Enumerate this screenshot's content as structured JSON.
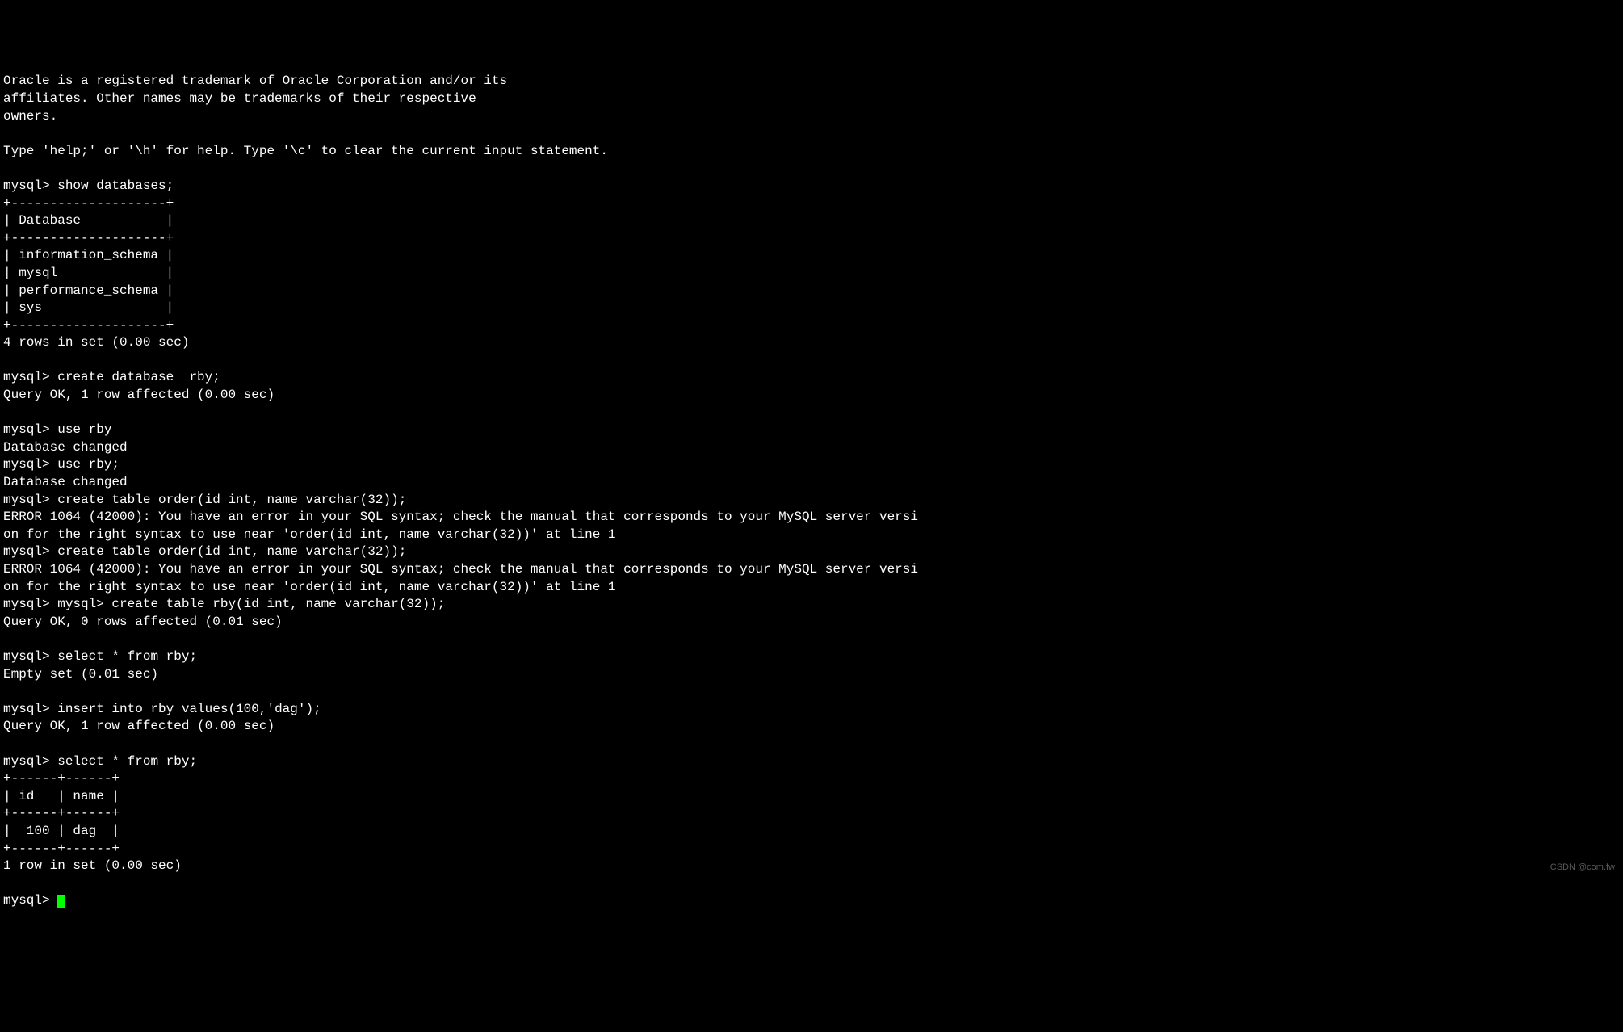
{
  "terminal": {
    "intro_line1": "Oracle is a registered trademark of Oracle Corporation and/or its",
    "intro_line2": "affiliates. Other names may be trademarks of their respective",
    "intro_line3": "owners.",
    "help_line": "Type 'help;' or '\\h' for help. Type '\\c' to clear the current input statement.",
    "prompt": "mysql> ",
    "cmd_show_databases": "show databases;",
    "table_border": "+--------------------+",
    "table_header": "| Database           |",
    "db_row1": "| information_schema |",
    "db_row2": "| mysql              |",
    "db_row3": "| performance_schema |",
    "db_row4": "| sys                |",
    "rows_result1": "4 rows in set (0.00 sec)",
    "cmd_create_db": "create database  rby;",
    "query_ok1": "Query OK, 1 row affected (0.00 sec)",
    "cmd_use_rby1": "use rby",
    "db_changed": "Database changed",
    "cmd_use_rby2": "use rby;",
    "cmd_create_table_order": "create table order(id int, name varchar(32));",
    "error_line1": "ERROR 1064 (42000): You have an error in your SQL syntax; check the manual that corresponds to your MySQL server versi",
    "error_line2": "on for the right syntax to use near 'order(id int, name varchar(32))' at line 1",
    "cmd_create_table_rby": "mysql> create table rby(id int, name varchar(32));",
    "query_ok2": "Query OK, 0 rows affected (0.01 sec)",
    "cmd_select1": "select * from rby;",
    "empty_set": "Empty set (0.01 sec)",
    "cmd_insert": "insert into rby values(100,'dag');",
    "query_ok3": "Query OK, 1 row affected (0.00 sec)",
    "cmd_select2": "select * from rby;",
    "result_border": "+------+------+",
    "result_header": "| id   | name |",
    "result_row": "|  100 | dag  |",
    "rows_result2": "1 row in set (0.00 sec)",
    "watermark": "CSDN @com.fw"
  }
}
